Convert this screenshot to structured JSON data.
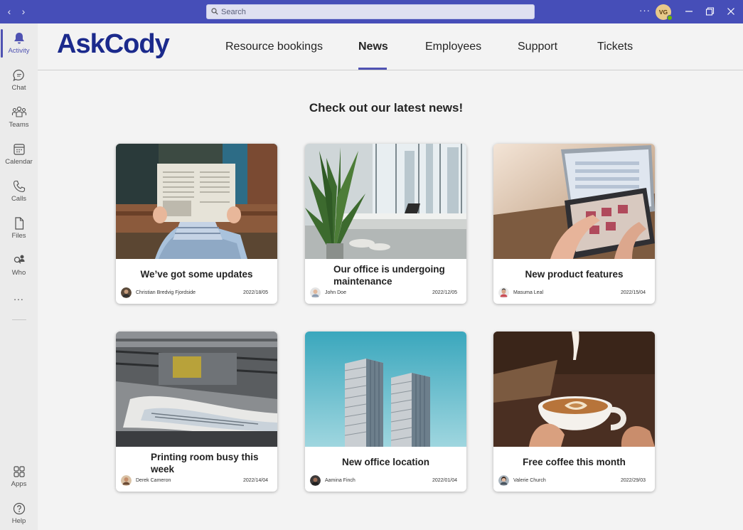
{
  "titlebar": {
    "search_placeholder": "Search",
    "more_label": "···",
    "user_initials": "VG"
  },
  "rail": {
    "items": [
      {
        "label": "Activity",
        "icon": "bell-icon"
      },
      {
        "label": "Chat",
        "icon": "chat-icon"
      },
      {
        "label": "Teams",
        "icon": "teams-icon"
      },
      {
        "label": "Calendar",
        "icon": "calendar-icon"
      },
      {
        "label": "Calls",
        "icon": "phone-icon"
      },
      {
        "label": "Files",
        "icon": "file-icon"
      },
      {
        "label": "Who",
        "icon": "people-icon"
      },
      {
        "label": "...",
        "icon": "more-icon"
      }
    ],
    "bottom": [
      {
        "label": "Apps",
        "icon": "apps-icon"
      },
      {
        "label": "Help",
        "icon": "help-icon"
      }
    ]
  },
  "app": {
    "logo": "AskCody",
    "tabs": [
      "Resource bookings",
      "News",
      "Employees",
      "Support",
      "Tickets"
    ],
    "active_tab": "News",
    "accent": "#4f52b2",
    "logo_color": "#1b2a8c"
  },
  "news": {
    "heading": "Check out our latest news!",
    "cards": [
      {
        "title": "We’ve got some updates",
        "author": "Christian Bredvig Fjordside",
        "date": "2022/18/05",
        "image": "person reading newspaper"
      },
      {
        "title": "Our office is undergoing maintenance",
        "author": "John Doe",
        "date": "2022/12/05",
        "image": "office interior with plants"
      },
      {
        "title": "New product features",
        "author": "Masuma Leal",
        "date": "2022/15/04",
        "image": "hands using tablet"
      },
      {
        "title": "Printing room busy this week",
        "author": "Derek Cameron",
        "date": "2022/14/04",
        "image": "printing press"
      },
      {
        "title": "New office location",
        "author": "Aamina Finch",
        "date": "2022/01/04",
        "image": "two office towers"
      },
      {
        "title": "Free coffee this month",
        "author": "Valerie Church",
        "date": "2022/29/03",
        "image": "latte art coffee cup"
      }
    ]
  }
}
